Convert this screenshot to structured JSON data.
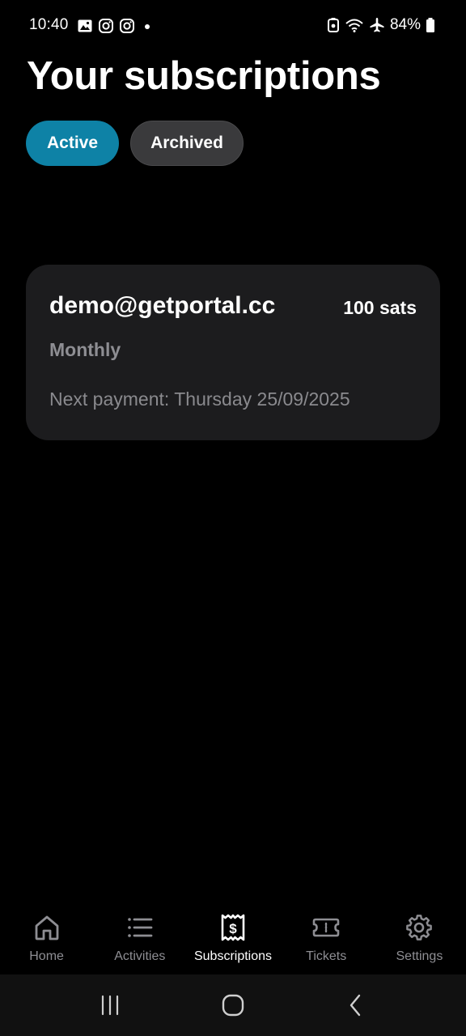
{
  "status_bar": {
    "time": "10:40",
    "battery": "84%",
    "left_icons": [
      "gallery-icon",
      "instagram-icon",
      "instagram-icon",
      "notification-dot"
    ],
    "right_icons": [
      "battery-saver-icon",
      "wifi-icon",
      "airplane-icon",
      "battery-icon"
    ]
  },
  "header": {
    "title": "Your subscriptions"
  },
  "tabs": [
    {
      "label": "Active",
      "selected": true
    },
    {
      "label": "Archived",
      "selected": false
    }
  ],
  "subscriptions": [
    {
      "email": "demo@getportal.cc",
      "amount": "100 sats",
      "frequency": "Monthly",
      "next_payment": "Next payment: Thursday 25/09/2025"
    }
  ],
  "bottom_nav": {
    "items": [
      {
        "label": "Home",
        "icon": "home-icon",
        "active": false
      },
      {
        "label": "Activities",
        "icon": "list-icon",
        "active": false
      },
      {
        "label": "Subscriptions",
        "icon": "receipt-dollar-icon",
        "active": true
      },
      {
        "label": "Tickets",
        "icon": "ticket-icon",
        "active": false
      },
      {
        "label": "Settings",
        "icon": "gear-icon",
        "active": false
      }
    ]
  },
  "system_nav": {
    "buttons": [
      "recents-icon",
      "home-circle-icon",
      "back-icon"
    ]
  },
  "colors": {
    "background": "#000000",
    "accent": "#0e82a6",
    "card": "#1c1c1e",
    "secondary_text": "#8e8e93",
    "inactive_tab": "#3a3a3c"
  }
}
